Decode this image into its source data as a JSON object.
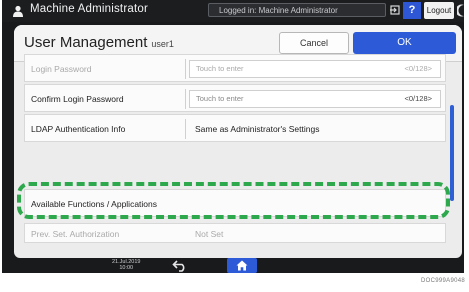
{
  "topbar": {
    "admin_label": "Machine Administrator",
    "logged_in_text": "Logged in: Machine Administrator",
    "help_label": "?",
    "logout_label": "Logout"
  },
  "header": {
    "title": "User Management",
    "subtitle": "user1",
    "cancel_label": "Cancel",
    "ok_label": "OK"
  },
  "rows": [
    {
      "label": "Login Password",
      "placeholder": "Touch to enter",
      "limit": "<0/128>"
    },
    {
      "label": "Confirm Login Password",
      "placeholder": "Touch to enter",
      "limit": "<0/128>"
    },
    {
      "label": "LDAP Authentication Info",
      "value": "Same as Administrator's Settings"
    },
    {
      "label": "Available Functions / Applications"
    },
    {
      "label": "Prev. Set. Authorization",
      "value": "Not Set"
    }
  ],
  "bottombar": {
    "date": "21.Jul.2019",
    "time": "10:00"
  },
  "figure_id": "DOC999A9048",
  "colors": {
    "accent": "#2d5bd8",
    "highlight": "#2ea84c",
    "background_dark": "#181a1c"
  }
}
